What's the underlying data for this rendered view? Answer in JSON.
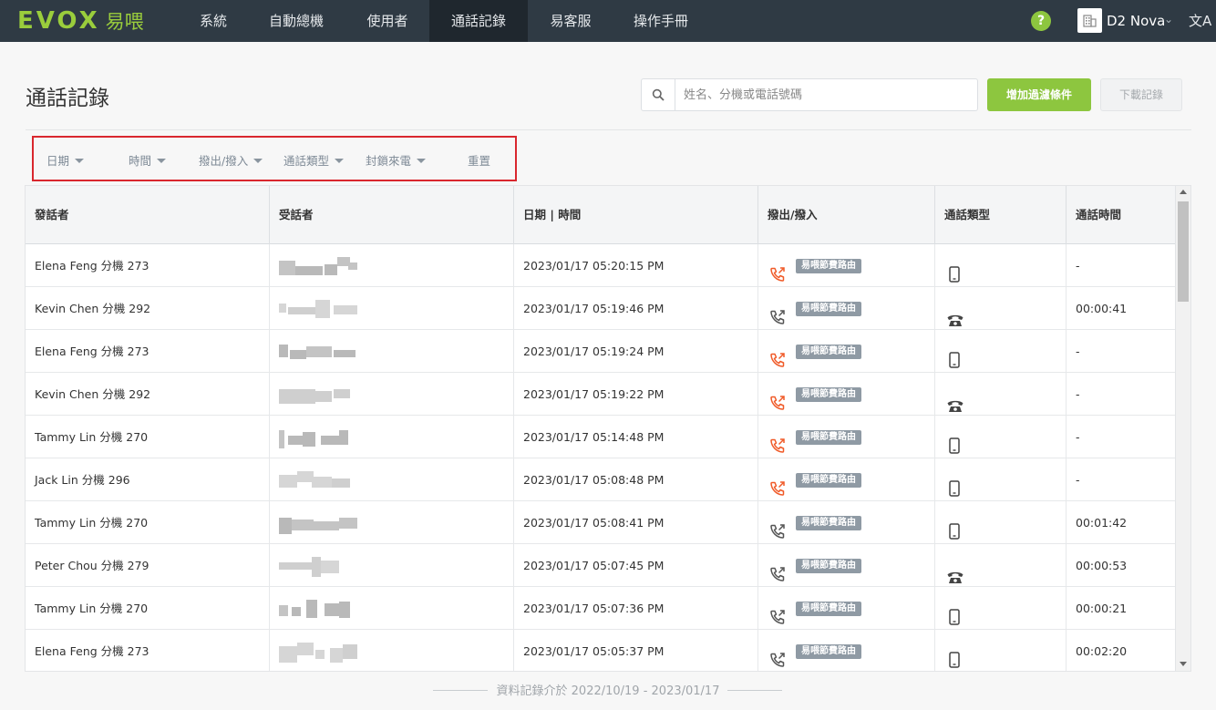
{
  "nav": {
    "logo_text": "EVOX",
    "logo_cn": "易喂",
    "items": [
      {
        "label": "系統"
      },
      {
        "label": "自動總機"
      },
      {
        "label": "使用者"
      },
      {
        "label": "通話記錄",
        "active": true
      },
      {
        "label": "易客服"
      },
      {
        "label": "操作手冊"
      }
    ],
    "help_label": "?",
    "org_name": "D2 Nova",
    "lang_icon": "translate-icon"
  },
  "page": {
    "title": "通話記錄",
    "search_placeholder": "姓名、分機或電話號碼",
    "add_filter_label": "增加過濾條件",
    "download_label": "下載記錄"
  },
  "filters": [
    {
      "label": "日期"
    },
    {
      "label": "時間"
    },
    {
      "label": "撥出/撥入"
    },
    {
      "label": "通話類型"
    },
    {
      "label": "封鎖來電"
    },
    {
      "label": "重置"
    }
  ],
  "table": {
    "headers": [
      "發話者",
      "受話者",
      "日期 | 時間",
      "撥出/撥入",
      "通話類型",
      "通話時間"
    ],
    "route_label": "易喂節費路由",
    "rows": [
      {
        "caller": "Elena Feng 分機 273",
        "datetime": "2023/01/17 05:20:15 PM",
        "direction": "outgoing-missed",
        "type": "mobile",
        "duration": "-"
      },
      {
        "caller": "Kevin Chen 分機 292",
        "datetime": "2023/01/17 05:19:46 PM",
        "direction": "outgoing",
        "type": "desk-phone",
        "duration": "00:00:41"
      },
      {
        "caller": "Elena Feng 分機 273",
        "datetime": "2023/01/17 05:19:24 PM",
        "direction": "outgoing-missed",
        "type": "mobile",
        "duration": "-"
      },
      {
        "caller": "Kevin Chen 分機 292",
        "datetime": "2023/01/17 05:19:22 PM",
        "direction": "outgoing-missed",
        "type": "desk-phone",
        "duration": "-"
      },
      {
        "caller": "Tammy Lin 分機 270",
        "datetime": "2023/01/17 05:14:48 PM",
        "direction": "outgoing-missed",
        "type": "mobile",
        "duration": "-"
      },
      {
        "caller": "Jack Lin 分機 296",
        "datetime": "2023/01/17 05:08:48 PM",
        "direction": "outgoing-missed",
        "type": "mobile",
        "duration": "-"
      },
      {
        "caller": "Tammy Lin 分機 270",
        "datetime": "2023/01/17 05:08:41 PM",
        "direction": "outgoing",
        "type": "mobile",
        "duration": "00:01:42"
      },
      {
        "caller": "Peter Chou 分機 279",
        "datetime": "2023/01/17 05:07:45 PM",
        "direction": "outgoing",
        "type": "desk-phone",
        "duration": "00:00:53"
      },
      {
        "caller": "Tammy Lin 分機 270",
        "datetime": "2023/01/17 05:07:36 PM",
        "direction": "outgoing",
        "type": "mobile",
        "duration": "00:00:21"
      },
      {
        "caller": "Elena Feng 分機 273",
        "datetime": "2023/01/17 05:05:37 PM",
        "direction": "outgoing",
        "type": "mobile",
        "duration": "00:02:20"
      }
    ]
  },
  "footer": {
    "note": "資料記錄介於 2022/10/19 - 2023/01/17"
  },
  "colors": {
    "nav_bg": "#2f3a44",
    "accent_green": "#8dc63f",
    "missed_red": "#f05a28",
    "filter_highlight": "#d9272e"
  }
}
